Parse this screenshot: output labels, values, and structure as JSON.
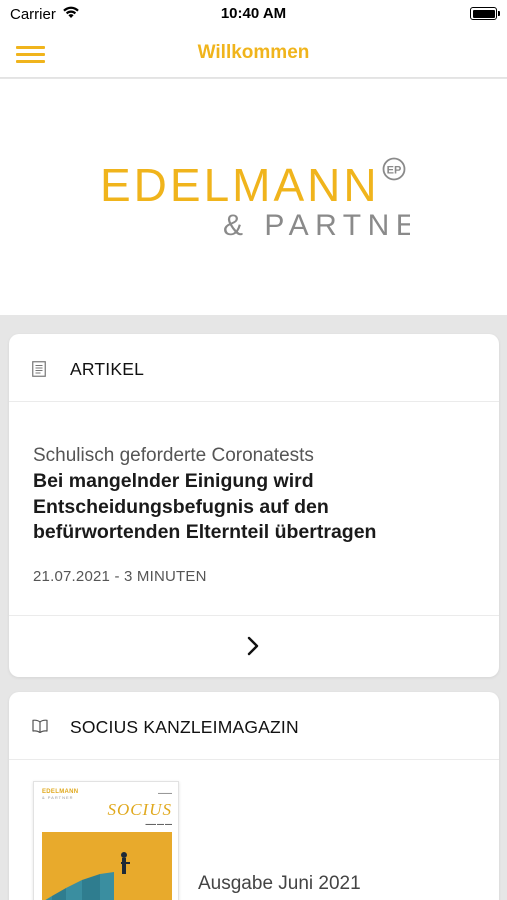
{
  "status_bar": {
    "carrier": "Carrier",
    "time": "10:40 AM"
  },
  "nav": {
    "title": "Willkommen",
    "menu_icon": "hamburger-menu-icon"
  },
  "logo": {
    "word1": "EDELMANN",
    "word2": "& PARTNER",
    "badge": "EP",
    "color": "#f0b41c"
  },
  "articles_card": {
    "icon": "article-list-icon",
    "title": "ARTIKEL",
    "kicker": "Schulisch geforderte Coronatests",
    "headline": "Bei mangelnder Einigung wird Entscheidungsbefugnis auf den befürwortenden Elternteil übertragen",
    "meta": "21.07.2021 - 3 MINUTEN",
    "next_icon": "chevron-right-icon"
  },
  "magazine_card": {
    "icon": "open-book-icon",
    "title": "SOCIUS KANZLEIMAGAZIN",
    "cover": {
      "brand": "EDELMANN",
      "brand_sub": "& PARTNER",
      "magazine_title": "SOCIUS"
    },
    "issue": "Ausgabe Juni 2021"
  },
  "colors": {
    "accent": "#f0b41c",
    "background": "#e6e6e6",
    "card": "#ffffff"
  }
}
